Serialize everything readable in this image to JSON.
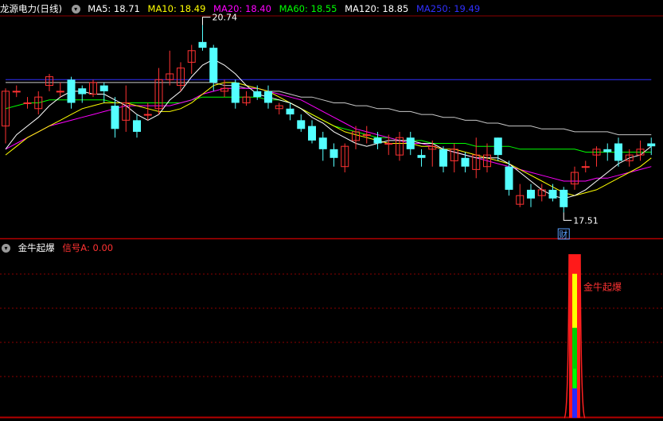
{
  "main_header": {
    "title": "龙源电力(日线)",
    "ma": [
      {
        "label": "MA5: 18.71",
        "color": "#ffffff"
      },
      {
        "label": "MA10: 18.49",
        "color": "#ffff00"
      },
      {
        "label": "MA20: 18.40",
        "color": "#ff00ff"
      },
      {
        "label": "MA60: 18.55",
        "color": "#00ff00"
      },
      {
        "label": "MA120: 18.85",
        "color": "#ffffff"
      },
      {
        "label": "MA250: 19.49",
        "color": "#0000ff"
      }
    ]
  },
  "sub_header": {
    "title": "金牛起爆",
    "signal": "信号A: 0.00"
  },
  "annotations": {
    "high_label": "20.74",
    "low_label": "17.51",
    "fin_badge": "财",
    "signal_label": "金牛起爆"
  },
  "colors": {
    "up": "#ff3232",
    "down": "#54ffff",
    "grid": "#8b0000",
    "border": "#b40000",
    "ma5": "#ffffff",
    "ma10": "#ffff00",
    "ma20": "#ff00ff",
    "ma60": "#00ff00",
    "ma120": "#c8c8c8",
    "ma250": "#3030ff"
  },
  "chart_data": {
    "type": "candlestick",
    "price_range": [
      17.2,
      20.9
    ],
    "candles": [
      [
        19.0,
        19.6,
        19.65,
        18.7
      ],
      [
        19.6,
        19.6,
        19.7,
        19.5
      ],
      [
        19.4,
        19.4,
        19.5,
        19.3
      ],
      [
        19.3,
        19.5,
        19.6,
        19.2
      ],
      [
        19.7,
        19.85,
        19.9,
        19.6
      ],
      [
        19.6,
        19.6,
        19.75,
        19.5
      ],
      [
        19.8,
        19.4,
        19.85,
        19.3
      ],
      [
        19.65,
        19.55,
        19.7,
        19.4
      ],
      [
        19.55,
        19.75,
        19.8,
        19.5
      ],
      [
        19.7,
        19.6,
        19.75,
        19.4
      ],
      [
        19.35,
        18.95,
        19.5,
        18.8
      ],
      [
        19.1,
        19.4,
        19.7,
        18.9
      ],
      [
        19.1,
        18.9,
        19.2,
        18.8
      ],
      [
        19.2,
        19.2,
        19.4,
        19.1
      ],
      [
        19.3,
        19.8,
        20.0,
        19.2
      ],
      [
        19.8,
        19.9,
        20.3,
        19.7
      ],
      [
        19.7,
        20.0,
        20.1,
        19.6
      ],
      [
        20.1,
        20.3,
        20.4,
        19.9
      ],
      [
        20.45,
        20.35,
        20.74,
        20.3
      ],
      [
        20.35,
        19.75,
        20.4,
        19.6
      ],
      [
        19.6,
        19.65,
        19.8,
        19.5
      ],
      [
        19.75,
        19.4,
        19.8,
        19.3
      ],
      [
        19.4,
        19.5,
        19.6,
        19.35
      ],
      [
        19.6,
        19.5,
        19.7,
        19.45
      ],
      [
        19.6,
        19.4,
        19.7,
        19.3
      ],
      [
        19.3,
        19.35,
        19.4,
        19.2
      ],
      [
        19.3,
        19.2,
        19.4,
        19.1
      ],
      [
        19.1,
        18.95,
        19.2,
        18.9
      ],
      [
        19.0,
        18.75,
        19.1,
        18.7
      ],
      [
        18.8,
        18.6,
        18.9,
        18.4
      ],
      [
        18.6,
        18.45,
        18.7,
        18.3
      ],
      [
        18.3,
        18.65,
        18.7,
        18.2
      ],
      [
        18.75,
        18.9,
        19.0,
        18.6
      ],
      [
        18.85,
        18.85,
        19.0,
        18.7
      ],
      [
        18.8,
        18.7,
        18.9,
        18.6
      ],
      [
        18.7,
        18.7,
        18.85,
        18.5
      ],
      [
        18.5,
        18.8,
        18.9,
        18.4
      ],
      [
        18.8,
        18.6,
        18.9,
        18.5
      ],
      [
        18.5,
        18.45,
        18.6,
        18.3
      ],
      [
        18.6,
        18.65,
        18.75,
        18.3
      ],
      [
        18.6,
        18.3,
        18.65,
        18.2
      ],
      [
        18.4,
        18.6,
        18.7,
        18.2
      ],
      [
        18.45,
        18.3,
        18.55,
        18.2
      ],
      [
        18.25,
        18.5,
        18.8,
        18.1
      ],
      [
        18.3,
        18.5,
        18.7,
        18.2
      ],
      [
        18.8,
        18.5,
        18.8,
        18.4
      ],
      [
        18.3,
        17.9,
        18.4,
        17.8
      ],
      [
        17.65,
        17.8,
        18.0,
        17.6
      ],
      [
        17.9,
        17.75,
        18.0,
        17.6
      ],
      [
        17.8,
        17.9,
        18.0,
        17.7
      ],
      [
        17.9,
        17.75,
        18.0,
        17.7
      ],
      [
        17.9,
        17.6,
        17.95,
        17.51
      ],
      [
        18.0,
        18.2,
        18.3,
        17.9
      ],
      [
        18.3,
        18.3,
        18.4,
        18.2
      ],
      [
        18.5,
        18.6,
        18.65,
        18.3
      ],
      [
        18.6,
        18.55,
        18.7,
        18.4
      ],
      [
        18.7,
        18.4,
        18.8,
        18.3
      ],
      [
        18.4,
        18.5,
        18.6,
        18.3
      ],
      [
        18.5,
        18.6,
        18.75,
        18.4
      ],
      [
        18.7,
        18.65,
        18.8,
        18.5
      ]
    ],
    "ma5": [
      18.6,
      18.85,
      19.0,
      19.15,
      19.35,
      19.5,
      19.6,
      19.6,
      19.55,
      19.55,
      19.45,
      19.35,
      19.2,
      19.1,
      19.2,
      19.45,
      19.6,
      19.85,
      20.05,
      20.15,
      20.05,
      19.9,
      19.7,
      19.55,
      19.5,
      19.45,
      19.4,
      19.3,
      19.15,
      19.05,
      18.9,
      18.8,
      18.7,
      18.65,
      18.7,
      18.75,
      18.75,
      18.75,
      18.7,
      18.7,
      18.6,
      18.55,
      18.5,
      18.45,
      18.45,
      18.45,
      18.35,
      18.2,
      18.05,
      17.9,
      17.8,
      17.75,
      17.8,
      17.9,
      18.05,
      18.2,
      18.35,
      18.45,
      18.5,
      18.65
    ],
    "ma10": [
      18.5,
      18.65,
      18.8,
      18.9,
      19.0,
      19.1,
      19.2,
      19.3,
      19.35,
      19.4,
      19.4,
      19.4,
      19.35,
      19.3,
      19.25,
      19.25,
      19.3,
      19.4,
      19.55,
      19.7,
      19.75,
      19.75,
      19.7,
      19.65,
      19.6,
      19.5,
      19.4,
      19.3,
      19.2,
      19.1,
      19.0,
      18.9,
      18.85,
      18.8,
      18.75,
      18.7,
      18.7,
      18.7,
      18.65,
      18.65,
      18.6,
      18.6,
      18.55,
      18.5,
      18.45,
      18.4,
      18.35,
      18.25,
      18.15,
      18.05,
      17.95,
      17.85,
      17.8,
      17.85,
      17.9,
      18.0,
      18.1,
      18.2,
      18.3,
      18.45
    ],
    "ma20": [
      18.6,
      18.7,
      18.8,
      18.9,
      19.0,
      19.05,
      19.1,
      19.15,
      19.2,
      19.25,
      19.3,
      19.35,
      19.35,
      19.35,
      19.35,
      19.35,
      19.4,
      19.45,
      19.55,
      19.6,
      19.65,
      19.65,
      19.65,
      19.65,
      19.6,
      19.55,
      19.5,
      19.45,
      19.35,
      19.25,
      19.15,
      19.05,
      18.95,
      18.9,
      18.85,
      18.8,
      18.75,
      18.7,
      18.7,
      18.65,
      18.6,
      18.55,
      18.5,
      18.45,
      18.4,
      18.35,
      18.3,
      18.25,
      18.2,
      18.15,
      18.1,
      18.05,
      18.05,
      18.05,
      18.1,
      18.1,
      18.15,
      18.2,
      18.25,
      18.3
    ],
    "ma60": [
      19.3,
      19.35,
      19.4,
      19.4,
      19.45,
      19.45,
      19.45,
      19.45,
      19.45,
      19.45,
      19.4,
      19.4,
      19.4,
      19.4,
      19.4,
      19.4,
      19.4,
      19.45,
      19.5,
      19.5,
      19.5,
      19.5,
      19.5,
      19.5,
      19.45,
      19.45,
      19.4,
      19.3,
      19.2,
      19.1,
      19.0,
      18.95,
      18.9,
      18.85,
      18.8,
      18.8,
      18.75,
      18.75,
      18.75,
      18.7,
      18.7,
      18.7,
      18.7,
      18.65,
      18.65,
      18.65,
      18.65,
      18.6,
      18.6,
      18.6,
      18.6,
      18.6,
      18.6,
      18.55,
      18.55,
      18.55,
      18.55,
      18.55,
      18.55,
      18.55
    ],
    "ma120": [
      19.75,
      19.75,
      19.75,
      19.75,
      19.75,
      19.75,
      19.75,
      19.75,
      19.75,
      19.75,
      19.75,
      19.75,
      19.75,
      19.75,
      19.75,
      19.75,
      19.75,
      19.75,
      19.75,
      19.75,
      19.7,
      19.7,
      19.65,
      19.65,
      19.6,
      19.6,
      19.55,
      19.5,
      19.5,
      19.45,
      19.4,
      19.4,
      19.35,
      19.35,
      19.3,
      19.3,
      19.25,
      19.25,
      19.2,
      19.2,
      19.15,
      19.15,
      19.1,
      19.1,
      19.05,
      19.05,
      19.0,
      19.0,
      19.0,
      18.95,
      18.95,
      18.95,
      18.9,
      18.9,
      18.9,
      18.9,
      18.85,
      18.85,
      18.85,
      18.85
    ],
    "ma250": [
      19.8,
      19.8,
      19.8,
      19.8,
      19.8,
      19.8,
      19.8,
      19.8,
      19.8,
      19.8,
      19.8,
      19.8,
      19.8,
      19.8,
      19.8,
      19.8,
      19.8,
      19.8,
      19.8,
      19.8,
      19.8,
      19.8,
      19.8,
      19.8,
      19.8,
      19.8,
      19.8,
      19.8,
      19.8,
      19.8,
      19.8,
      19.8,
      19.8,
      19.8,
      19.8,
      19.8,
      19.8,
      19.8,
      19.8,
      19.8,
      19.8,
      19.8,
      19.8,
      19.8,
      19.8,
      19.8,
      19.8,
      19.8,
      19.8,
      19.8,
      19.8,
      19.8,
      19.8,
      19.8,
      19.8,
      19.8,
      19.8,
      19.8,
      19.8,
      19.8
    ],
    "signal": {
      "index": 52,
      "value": 1.0
    }
  }
}
